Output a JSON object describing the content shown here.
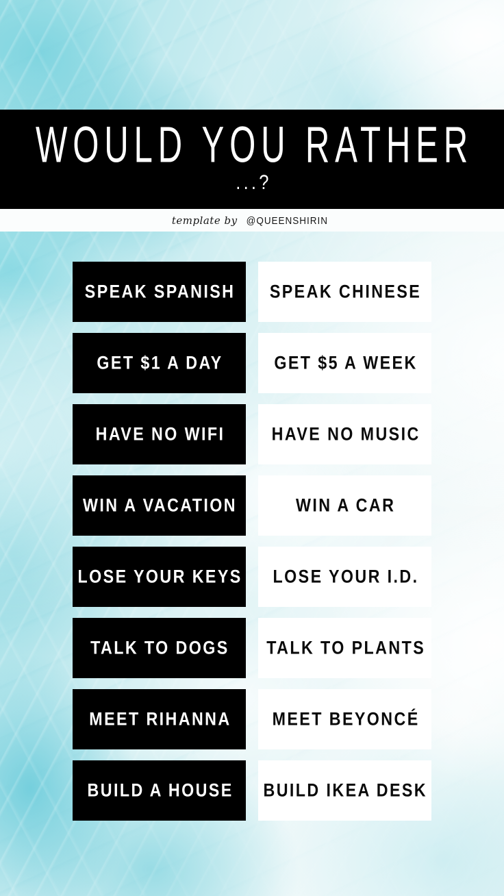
{
  "header": {
    "title": "WOULD YOU RATHER",
    "subtitle": "...?",
    "credit_prefix": "template by",
    "credit_handle": "@QUEENSHIRIN"
  },
  "theme": {
    "band_color": "#000000",
    "credit_band_color": "#FBFDFD",
    "left_box_color": "#000000",
    "left_text_color": "#FFFFFF",
    "right_box_color": "#FFFFFF",
    "right_text_color": "#0A0A0A",
    "background_accent": "#9DDFE6"
  },
  "rows": [
    {
      "left": "SPEAK SPANISH",
      "right": "SPEAK CHINESE"
    },
    {
      "left": "GET $1 A DAY",
      "right": "GET $5 A WEEK"
    },
    {
      "left": "HAVE NO WIFI",
      "right": "HAVE NO MUSIC"
    },
    {
      "left": "WIN A VACATION",
      "right": "WIN A CAR"
    },
    {
      "left": "LOSE YOUR KEYS",
      "right": "LOSE YOUR I.D."
    },
    {
      "left": "TALK TO DOGS",
      "right": "TALK TO PLANTS"
    },
    {
      "left": "MEET RIHANNA",
      "right": "MEET BEYONCÉ"
    },
    {
      "left": "BUILD A HOUSE",
      "right": "BUILD IKEA DESK"
    }
  ]
}
